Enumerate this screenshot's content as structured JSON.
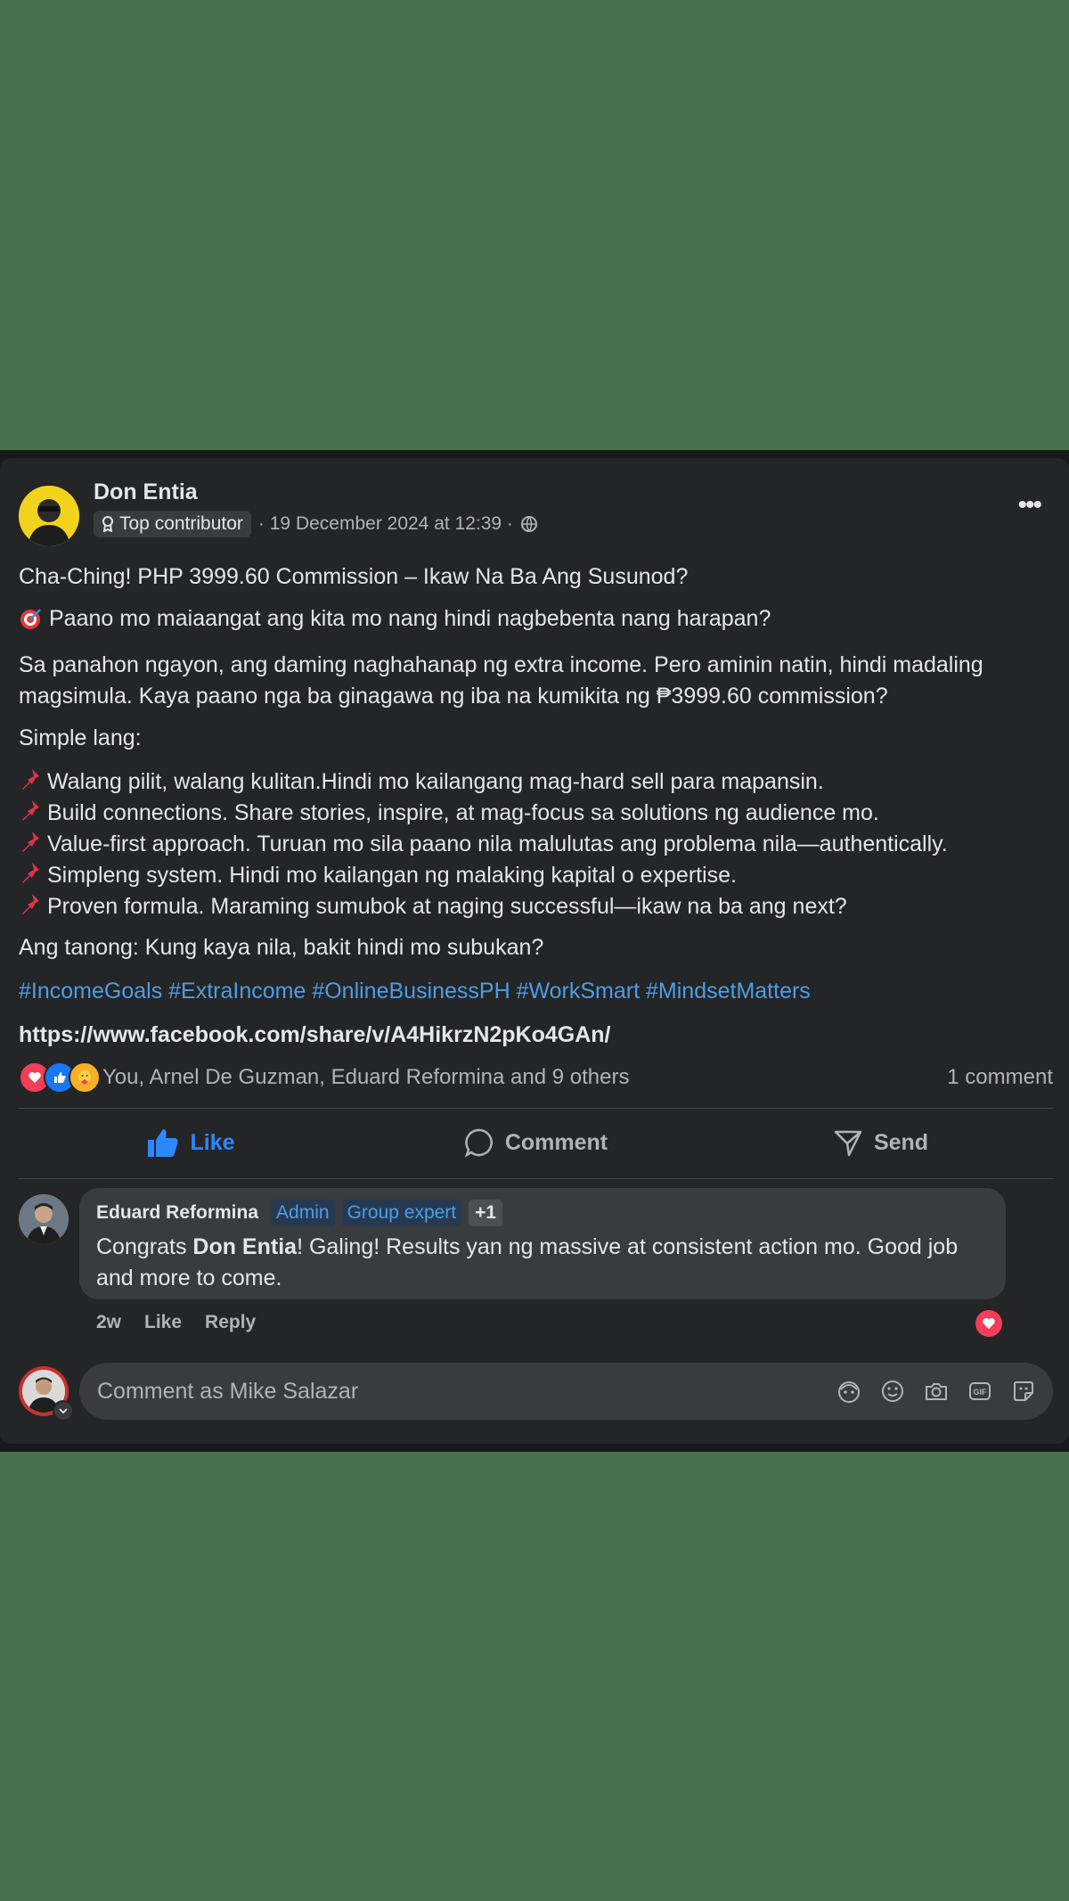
{
  "post": {
    "author": "Don Entia",
    "badge": "Top contributor",
    "timestamp": "· 19 December 2024 at 12:39 ·",
    "more": "•••",
    "title": "Cha-Ching! PHP 3999.60 Commission – Ikaw Na Ba Ang Susunod?",
    "question": "Paano mo maiaangat ang kita mo nang hindi nagbebenta nang harapan?",
    "paragraph": "Sa panahon ngayon, ang daming naghahanap ng extra income. Pero aminin natin, hindi madaling magsimula. Kaya paano nga ba ginagawa ng iba na kumikita ng ₱3999.60 commission?",
    "simple": "Simple lang:",
    "bullets": [
      "Walang pilit, walang kulitan.Hindi mo kailangang mag-hard sell para mapansin.",
      "Build connections. Share stories, inspire, at mag-focus sa solutions ng audience mo.",
      "Value-first approach. Turuan mo sila paano nila malulutas ang problema nila—authentically.",
      "Simpleng system. Hindi mo kailangan ng malaking kapital o expertise.",
      "Proven formula. Maraming sumubok at naging successful—ikaw na ba ang next?"
    ],
    "closing": "Ang tanong: Kung kaya nila, bakit hindi mo subukan?",
    "hashtags": "#IncomeGoals #ExtraIncome #OnlineBusinessPH #WorkSmart #MindsetMatters",
    "link": "https://www.facebook.com/share/v/A4HikrzN2pKo4GAn/"
  },
  "reactions": {
    "icons": [
      "love-reaction-icon",
      "like-reaction-icon",
      "care-reaction-icon"
    ],
    "summary": "You, Arnel De Guzman, Eduard Reformina and 9 others",
    "comment_count": "1 comment"
  },
  "actions": {
    "like": "Like",
    "comment": "Comment",
    "send": "Send"
  },
  "comment": {
    "author": "Eduard Reformina",
    "tags": [
      "Admin",
      "Group expert"
    ],
    "extra": "+1",
    "text_before": "Congrats ",
    "mention": "Don Entia",
    "text_after": "! Galing! Results yan ng massive at consistent action mo. Good job and more to come.",
    "age": "2w",
    "like": "Like",
    "reply": "Reply"
  },
  "composer": {
    "placeholder": "Comment as Mike Salazar"
  },
  "colors": {
    "accent": "#2d88ff",
    "link": "#4d9de6",
    "love": "#f33e58",
    "background": "#48714d",
    "card": "#242526"
  }
}
